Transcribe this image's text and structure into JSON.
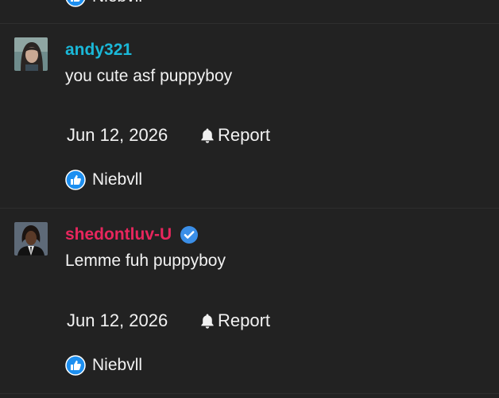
{
  "colors": {
    "background": "#222222",
    "text": "#f2f2f2",
    "username_1": "#1ab8d8",
    "username_2": "#e8265d",
    "verified": "#3b8fe8",
    "like": "#1d8ff0"
  },
  "partial_like": {
    "label": "Niebvll",
    "icon": "thumbs-up-icon"
  },
  "comments": [
    {
      "username": "andy321",
      "verified": false,
      "text": "you cute asf puppyboy",
      "date": "Jun 12, 2026",
      "report_label": "Report",
      "like_label": "Niebvll"
    },
    {
      "username": "shedontluv-U",
      "verified": true,
      "text": "Lemme fuh puppyboy",
      "date": "Jun 12, 2026",
      "report_label": "Report",
      "like_label": "Niebvll"
    }
  ]
}
